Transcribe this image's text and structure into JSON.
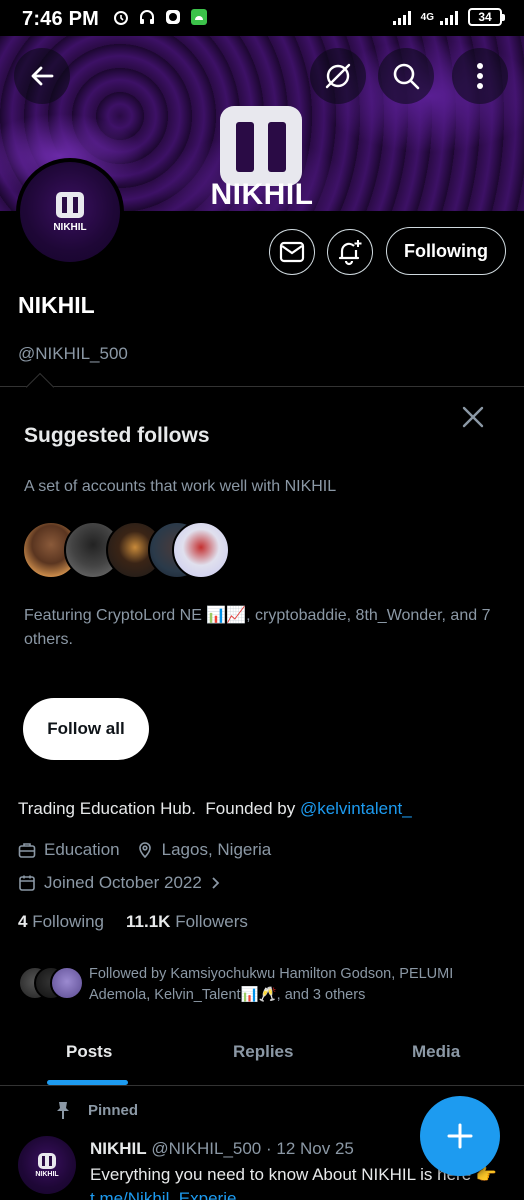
{
  "status_bar": {
    "time": "7:46 PM",
    "network": "4G",
    "battery": "34"
  },
  "banner": {
    "title": "NIKHIL"
  },
  "avatar": {
    "text": "NIKHIL"
  },
  "profile": {
    "following_button": "Following",
    "name": "NIKHIL",
    "handle": "@NIKHIL_500",
    "bio_text": "Trading Education Hub.  Founded by ",
    "bio_link": "@kelvintalent_",
    "category": "Education",
    "location": "Lagos, Nigeria",
    "joined": "Joined October 2022",
    "following_count": "4",
    "following_label": "Following",
    "followers_count": "11.1K",
    "followers_label": "Followers"
  },
  "suggested": {
    "title": "Suggested follows",
    "subtitle": "A set of accounts that work well with NIKHIL",
    "featuring": "Featuring CryptoLord NE 📊📈, cryptobaddie, 8th_Wonder, and 7 others.",
    "follow_all": "Follow all"
  },
  "followed_by": {
    "text": "Followed by Kamsiyochukwu Hamilton Godson, PELUMI Ademola, Kelvin_Talent📊🥂, and 3 others"
  },
  "tabs": [
    "Posts",
    "Replies",
    "Media"
  ],
  "post": {
    "pinned_label": "Pinned",
    "author": "NIKHIL",
    "handle_date": " @NIKHIL_500 · 12 Nov 25",
    "body": "Everything you need to know About NIKHIL is here 👉",
    "link": "t.me/Nikhil_Experie..."
  },
  "colors": {
    "accent": "#1d9bf0",
    "background": "#000000",
    "secondary_text": "#8b98a5"
  },
  "icons": [
    "back-arrow-icon",
    "hide-icon",
    "search-icon",
    "more-vertical-icon",
    "mail-icon",
    "bell-plus-icon",
    "close-icon",
    "briefcase-icon",
    "location-pin-icon",
    "calendar-icon",
    "chevron-right-icon",
    "pin-icon",
    "plus-icon"
  ]
}
